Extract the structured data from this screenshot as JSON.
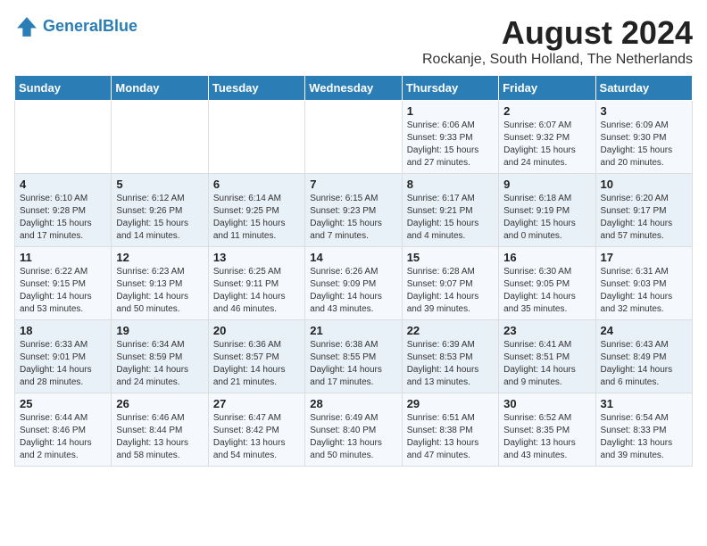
{
  "header": {
    "logo_line1": "General",
    "logo_line2": "Blue",
    "month_year": "August 2024",
    "location": "Rockanje, South Holland, The Netherlands"
  },
  "weekdays": [
    "Sunday",
    "Monday",
    "Tuesday",
    "Wednesday",
    "Thursday",
    "Friday",
    "Saturday"
  ],
  "weeks": [
    [
      {
        "day": "",
        "text": ""
      },
      {
        "day": "",
        "text": ""
      },
      {
        "day": "",
        "text": ""
      },
      {
        "day": "",
        "text": ""
      },
      {
        "day": "1",
        "text": "Sunrise: 6:06 AM\nSunset: 9:33 PM\nDaylight: 15 hours\nand 27 minutes."
      },
      {
        "day": "2",
        "text": "Sunrise: 6:07 AM\nSunset: 9:32 PM\nDaylight: 15 hours\nand 24 minutes."
      },
      {
        "day": "3",
        "text": "Sunrise: 6:09 AM\nSunset: 9:30 PM\nDaylight: 15 hours\nand 20 minutes."
      }
    ],
    [
      {
        "day": "4",
        "text": "Sunrise: 6:10 AM\nSunset: 9:28 PM\nDaylight: 15 hours\nand 17 minutes."
      },
      {
        "day": "5",
        "text": "Sunrise: 6:12 AM\nSunset: 9:26 PM\nDaylight: 15 hours\nand 14 minutes."
      },
      {
        "day": "6",
        "text": "Sunrise: 6:14 AM\nSunset: 9:25 PM\nDaylight: 15 hours\nand 11 minutes."
      },
      {
        "day": "7",
        "text": "Sunrise: 6:15 AM\nSunset: 9:23 PM\nDaylight: 15 hours\nand 7 minutes."
      },
      {
        "day": "8",
        "text": "Sunrise: 6:17 AM\nSunset: 9:21 PM\nDaylight: 15 hours\nand 4 minutes."
      },
      {
        "day": "9",
        "text": "Sunrise: 6:18 AM\nSunset: 9:19 PM\nDaylight: 15 hours\nand 0 minutes."
      },
      {
        "day": "10",
        "text": "Sunrise: 6:20 AM\nSunset: 9:17 PM\nDaylight: 14 hours\nand 57 minutes."
      }
    ],
    [
      {
        "day": "11",
        "text": "Sunrise: 6:22 AM\nSunset: 9:15 PM\nDaylight: 14 hours\nand 53 minutes."
      },
      {
        "day": "12",
        "text": "Sunrise: 6:23 AM\nSunset: 9:13 PM\nDaylight: 14 hours\nand 50 minutes."
      },
      {
        "day": "13",
        "text": "Sunrise: 6:25 AM\nSunset: 9:11 PM\nDaylight: 14 hours\nand 46 minutes."
      },
      {
        "day": "14",
        "text": "Sunrise: 6:26 AM\nSunset: 9:09 PM\nDaylight: 14 hours\nand 43 minutes."
      },
      {
        "day": "15",
        "text": "Sunrise: 6:28 AM\nSunset: 9:07 PM\nDaylight: 14 hours\nand 39 minutes."
      },
      {
        "day": "16",
        "text": "Sunrise: 6:30 AM\nSunset: 9:05 PM\nDaylight: 14 hours\nand 35 minutes."
      },
      {
        "day": "17",
        "text": "Sunrise: 6:31 AM\nSunset: 9:03 PM\nDaylight: 14 hours\nand 32 minutes."
      }
    ],
    [
      {
        "day": "18",
        "text": "Sunrise: 6:33 AM\nSunset: 9:01 PM\nDaylight: 14 hours\nand 28 minutes."
      },
      {
        "day": "19",
        "text": "Sunrise: 6:34 AM\nSunset: 8:59 PM\nDaylight: 14 hours\nand 24 minutes."
      },
      {
        "day": "20",
        "text": "Sunrise: 6:36 AM\nSunset: 8:57 PM\nDaylight: 14 hours\nand 21 minutes."
      },
      {
        "day": "21",
        "text": "Sunrise: 6:38 AM\nSunset: 8:55 PM\nDaylight: 14 hours\nand 17 minutes."
      },
      {
        "day": "22",
        "text": "Sunrise: 6:39 AM\nSunset: 8:53 PM\nDaylight: 14 hours\nand 13 minutes."
      },
      {
        "day": "23",
        "text": "Sunrise: 6:41 AM\nSunset: 8:51 PM\nDaylight: 14 hours\nand 9 minutes."
      },
      {
        "day": "24",
        "text": "Sunrise: 6:43 AM\nSunset: 8:49 PM\nDaylight: 14 hours\nand 6 minutes."
      }
    ],
    [
      {
        "day": "25",
        "text": "Sunrise: 6:44 AM\nSunset: 8:46 PM\nDaylight: 14 hours\nand 2 minutes."
      },
      {
        "day": "26",
        "text": "Sunrise: 6:46 AM\nSunset: 8:44 PM\nDaylight: 13 hours\nand 58 minutes."
      },
      {
        "day": "27",
        "text": "Sunrise: 6:47 AM\nSunset: 8:42 PM\nDaylight: 13 hours\nand 54 minutes."
      },
      {
        "day": "28",
        "text": "Sunrise: 6:49 AM\nSunset: 8:40 PM\nDaylight: 13 hours\nand 50 minutes."
      },
      {
        "day": "29",
        "text": "Sunrise: 6:51 AM\nSunset: 8:38 PM\nDaylight: 13 hours\nand 47 minutes."
      },
      {
        "day": "30",
        "text": "Sunrise: 6:52 AM\nSunset: 8:35 PM\nDaylight: 13 hours\nand 43 minutes."
      },
      {
        "day": "31",
        "text": "Sunrise: 6:54 AM\nSunset: 8:33 PM\nDaylight: 13 hours\nand 39 minutes."
      }
    ]
  ]
}
